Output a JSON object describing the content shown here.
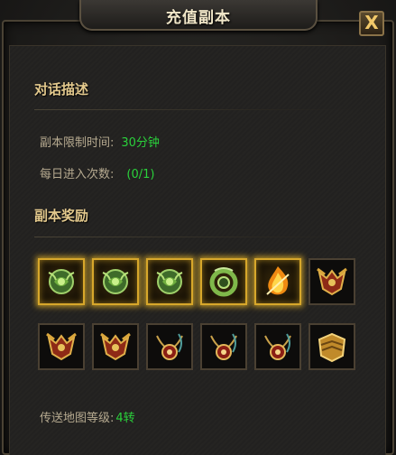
{
  "window": {
    "title": "充值副本",
    "close_label": "X"
  },
  "dialog_section": {
    "title": "对话描述",
    "rows": [
      {
        "label": "副本限制时间:",
        "value": "30分钟"
      },
      {
        "label": "每日进入次数:",
        "value": "(0/1)"
      }
    ]
  },
  "rewards_section": {
    "title": "副本奖励",
    "items": [
      {
        "icon": "jade-pendant-icon",
        "glow": true
      },
      {
        "icon": "jade-pendant-icon",
        "glow": true
      },
      {
        "icon": "jade-pendant-icon",
        "glow": true
      },
      {
        "icon": "jade-ring-icon",
        "glow": true
      },
      {
        "icon": "flame-gem-icon",
        "glow": true
      },
      {
        "icon": "gold-helmet-icon",
        "glow": false
      },
      {
        "icon": "gold-helmet-icon",
        "glow": false
      },
      {
        "icon": "gold-helmet-icon",
        "glow": false
      },
      {
        "icon": "ornate-necklace-icon",
        "glow": false
      },
      {
        "icon": "ornate-necklace-icon",
        "glow": false
      },
      {
        "icon": "ornate-necklace-icon",
        "glow": false
      },
      {
        "icon": "gold-armor-icon",
        "glow": false
      }
    ]
  },
  "footer": {
    "label": "传送地图等级:",
    "value": "4转"
  },
  "colors": {
    "accent_gold": "#e3c98d",
    "value_green": "#2ad13b",
    "label_tan": "#b6aa90"
  }
}
